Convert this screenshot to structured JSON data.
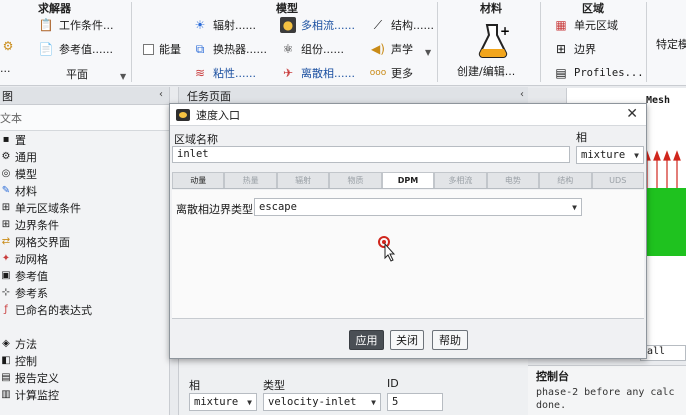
{
  "ribbon": {
    "solver": {
      "title": "求解器",
      "work_conditions": "工作条件...",
      "reference_values": "参考值......",
      "plane": "平面",
      "energy": "能量",
      "partial": "..."
    },
    "model": {
      "title": "模型",
      "radiation": "辐射......",
      "heat_exchanger": "换热器......",
      "viscous": "粘性......",
      "multiphase": "多相流......",
      "species": "组份......",
      "discrete_phase": "离散相......",
      "structure": "结构......",
      "acoustics": "声学",
      "more": "更多"
    },
    "materials": {
      "title": "材料",
      "create_edit": "创建/编辑..."
    },
    "zones": {
      "title": "区域",
      "cell_zones": "单元区域",
      "boundaries": "边界",
      "profiles": "Profiles..."
    },
    "special": {
      "label": "特定模"
    }
  },
  "left_panel": {
    "header": "图",
    "search_placeholder": "文本",
    "collapse_icon": "‹",
    "items": [
      {
        "label": "置",
        "icon": "folder"
      },
      {
        "label": "通用",
        "icon": "gear"
      },
      {
        "label": "模型",
        "icon": "models"
      },
      {
        "label": "材料",
        "icon": "materials"
      },
      {
        "label": "单元区域条件",
        "icon": "grid"
      },
      {
        "label": "边界条件",
        "icon": "grid"
      },
      {
        "label": "网格交界面",
        "icon": "interface"
      },
      {
        "label": "动网格",
        "icon": "dynamic-mesh"
      },
      {
        "label": "参考值",
        "icon": "reference"
      },
      {
        "label": "参考系",
        "icon": "axes"
      },
      {
        "label": "已命名的表达式",
        "icon": "expression"
      },
      {
        "label": "",
        "icon": "blank"
      },
      {
        "label": "方法",
        "icon": "method"
      },
      {
        "label": "控制",
        "icon": "control"
      },
      {
        "label": "报告定义",
        "icon": "report"
      },
      {
        "label": "计算监控",
        "icon": "monitor"
      }
    ]
  },
  "task_panel": {
    "header": "任务页面",
    "phase_label": "相",
    "type_label": "类型",
    "id_label": "ID",
    "phase_value": "mixture",
    "type_value": "velocity-inlet",
    "id_value": "5"
  },
  "graphics": {
    "mesh_title": "Mesh",
    "all_label": "all",
    "console_title": "控制台",
    "console_lines": [
      "phase-2 before any calc",
      "done."
    ]
  },
  "dialog": {
    "title": "速度入口",
    "zone_name_label": "区域名称",
    "zone_name_value": "inlet",
    "phase_label": "相",
    "phase_value": "mixture",
    "tabs": [
      "动量",
      "热量",
      "辐射",
      "物质",
      "DPM",
      "多相流",
      "电势",
      "结构",
      "UDS"
    ],
    "active_tab": "DPM",
    "dpm_bc_type_label": "离散相边界类型",
    "dpm_bc_type_value": "escape",
    "buttons": {
      "apply": "应用",
      "close": "关闭",
      "help": "帮助"
    },
    "close_icon": "✕"
  },
  "colors": {
    "accent_red": "#d0261d",
    "mesh_green": "#1fc21f",
    "dark_button": "#4a4f55"
  }
}
